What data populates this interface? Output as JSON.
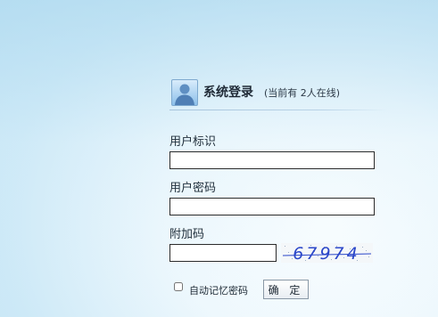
{
  "login": {
    "title": "系统登录",
    "online_status": "(当前有 2人在线)",
    "username": {
      "label": "用户标识",
      "value": ""
    },
    "password": {
      "label": "用户密码",
      "value": ""
    },
    "captcha": {
      "label": "附加码",
      "value": "",
      "image_text": "67974"
    },
    "remember": {
      "label": "自动记忆密码",
      "checked": false
    },
    "submit_label": "确 定"
  },
  "colors": {
    "accent": "#2a46c9",
    "background": "#cde9f7",
    "input_border": "#2b2b2b"
  },
  "icons": {
    "avatar": "user-avatar-icon"
  }
}
